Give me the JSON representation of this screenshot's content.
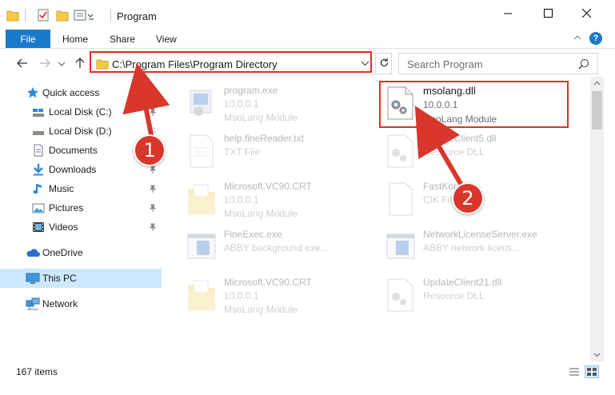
{
  "window": {
    "title": "Program",
    "minimize_icon": "minimize-icon",
    "maximize_icon": "maximize-icon",
    "close_icon": "close-icon"
  },
  "ribbon": {
    "tabs": [
      {
        "label": "File",
        "active": true
      },
      {
        "label": "Home"
      },
      {
        "label": "Share"
      },
      {
        "label": "View"
      }
    ],
    "accent": "#1979ca",
    "help_label": "?"
  },
  "address": {
    "path": "C:\\Program Files\\Program Directory",
    "search_placeholder": "Search Program"
  },
  "nav": {
    "items": [
      {
        "label": "Quick access",
        "icon": "star-icon",
        "pinned": false
      },
      {
        "label": "Local Disk (C:)",
        "icon": "drive-icon",
        "pinned": true
      },
      {
        "label": "Local Disk (D:)",
        "icon": "drive-icon",
        "pinned": true
      },
      {
        "label": "Documents",
        "icon": "documents-icon",
        "pinned": true
      },
      {
        "label": "Downloads",
        "icon": "download-icon",
        "pinned": true
      },
      {
        "label": "Music",
        "icon": "music-icon",
        "pinned": true
      },
      {
        "label": "Pictures",
        "icon": "pictures-icon",
        "pinned": true
      },
      {
        "label": "Videos",
        "icon": "videos-icon",
        "pinned": true
      },
      {
        "label": "OneDrive",
        "icon": "cloud-icon",
        "pinned": false
      },
      {
        "label": "This PC",
        "icon": "computer-icon",
        "pinned": false,
        "selected": true
      },
      {
        "label": "Network",
        "icon": "network-icon",
        "pinned": false
      }
    ],
    "selected_color": "#cce8ff"
  },
  "files": [
    {
      "name": "program.exe",
      "line1": "10.0.0.1",
      "line2": "MsoLang Module",
      "icon": "exe-icon",
      "faded": true
    },
    {
      "name": "msolang.dll",
      "line1": "10.0.0.1",
      "line2": "MsoLang Module",
      "icon": "dll-gear-icon",
      "faded": false,
      "highlighted": true
    },
    {
      "name": "help.fineReader.txt",
      "line1": "TXT File",
      "line2": "",
      "icon": "text-file-icon",
      "faded": true
    },
    {
      "name": "UpdateClient5.dll",
      "line1": "Resource DLL",
      "line2": "",
      "icon": "dll-gear-icon",
      "faded": true
    },
    {
      "name": "Microsoft.VC90.CRT",
      "line1": "10.0.0.1",
      "line2": "MsoLang Module",
      "icon": "folder-icon",
      "faded": true
    },
    {
      "name": "FastKorea",
      "line1": "CIK File",
      "line2": "",
      "icon": "blank-file-icon",
      "faded": true
    },
    {
      "name": "FineExec.exe",
      "line1": "ABBY background exe...",
      "line2": "",
      "icon": "app-window-icon",
      "faded": true
    },
    {
      "name": "NetworkLicenseServer.exe",
      "line1": "ABBY network licens...",
      "line2": "",
      "icon": "app-window-icon",
      "faded": true
    },
    {
      "name": "Microsoft.VC90.CRT",
      "line1": "10.0.0.1",
      "line2": "MsoLang Module",
      "icon": "folder-icon",
      "faded": true
    },
    {
      "name": "UpdateClient21.dll",
      "line1": "Resource DLL",
      "line2": "",
      "icon": "dll-gear-icon",
      "faded": true
    }
  ],
  "status": {
    "item_count": "167 items"
  },
  "annotations": {
    "step1": "1",
    "step2": "2",
    "color": "#d9362c"
  }
}
